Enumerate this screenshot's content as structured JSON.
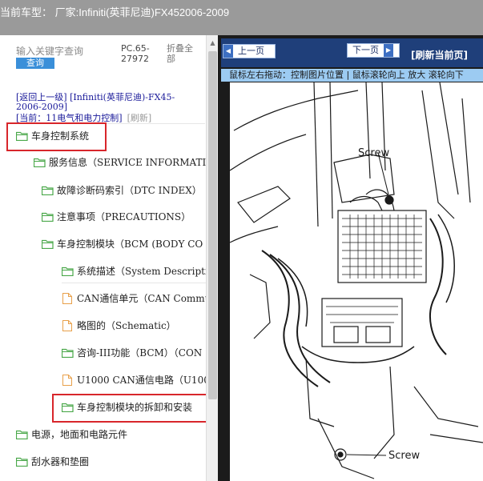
{
  "header": {
    "title": "当前车型： 厂家:Infiniti(英菲尼迪)FX452006-2009"
  },
  "search": {
    "placeholder": "输入关键字查询",
    "button_label": "查询"
  },
  "info": {
    "pc_code": "PC.65-27972",
    "collapse_label": "折叠全部"
  },
  "breadcrumb": {
    "back_line": "[返回上一级] [Infiniti(英菲尼迪)-FX45-2006-2009]",
    "current_line": "[当前：11电气和电力控制]",
    "refresh_label": "[刷新]"
  },
  "tree": {
    "items": [
      {
        "label": "车身控制系统",
        "icon": "folder-icon",
        "highlighted": true
      },
      {
        "label": "服务信息（SERVICE INFORMATIC",
        "icon": "folder-icon"
      },
      {
        "label": "故障诊断码索引（DTC INDEX）",
        "icon": "folder-icon"
      },
      {
        "label": "注意事项（PRECAUTIONS）",
        "icon": "folder-icon"
      },
      {
        "label": "车身控制模块（BCM (BODY CO",
        "icon": "folder-icon"
      },
      {
        "label": "系统描述（System Descriptic",
        "icon": "folder-icon"
      },
      {
        "label": "CAN通信单元（CAN Commu",
        "icon": "document-icon"
      },
      {
        "label": "略图的（Schematic）",
        "icon": "document-icon"
      },
      {
        "label": "咨询-III功能（BCM）（CON",
        "icon": "folder-icon"
      },
      {
        "label": "U1000 CAN通信电路（U100",
        "icon": "document-icon"
      },
      {
        "label": "车身控制模块的拆卸和安装",
        "icon": "folder-icon",
        "highlighted": true
      },
      {
        "label": "电源，地面和电路元件",
        "icon": "folder-icon"
      },
      {
        "label": "刮水器和垫圈",
        "icon": "folder-icon"
      }
    ]
  },
  "viewer": {
    "prev_label": "上一页",
    "next_label": "下一页",
    "refresh_label": "[刷新当前页]",
    "hint_text": "鼠标左右拖动：控制图片位置 | 鼠标滚轮向上 放大  滚轮向下",
    "labels": {
      "screw_top": "Screw",
      "screw_bottom": "Screw"
    }
  },
  "colors": {
    "highlight_box": "#d8262b",
    "folder": "#4aa84a",
    "document": "#e8a04a",
    "viewer_bar": "#1f3f7a",
    "hint_bar": "#9ccbf2"
  }
}
